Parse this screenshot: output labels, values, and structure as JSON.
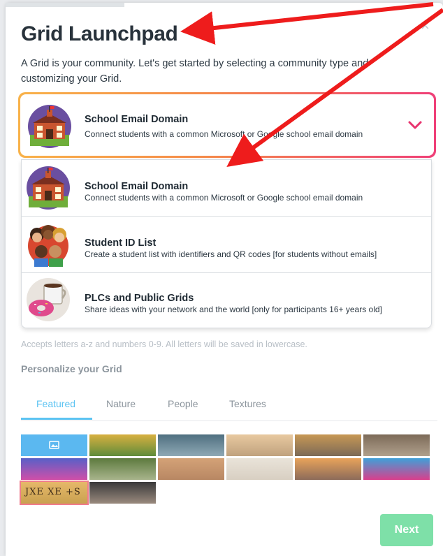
{
  "modal": {
    "title": "Grid Launchpad",
    "close_symbol": "×",
    "intro": "A Grid is your community. Let's get started by selecting a community type and customizing your Grid."
  },
  "selected_type": {
    "title": "School Email Domain",
    "description": "Connect students with a common Microsoft or Google school email domain",
    "icon": "school-building-icon"
  },
  "options": [
    {
      "title": "School Email Domain",
      "description": "Connect students with a common Microsoft or Google school email domain",
      "icon": "school-building-icon"
    },
    {
      "title": "Student ID List",
      "description": "Create a student list with identifiers and QR codes [for students without emails]",
      "icon": "students-group-icon"
    },
    {
      "title": "PLCs and Public Grids",
      "description": "Share ideas with your network and the world [only for participants 16+ years old]",
      "icon": "coffee-donut-icon"
    }
  ],
  "hint": "Accepts letters a-z and numbers 0-9. All letters will be saved in lowercase.",
  "personalize": {
    "label": "Personalize your Grid",
    "tabs": [
      {
        "label": "Featured",
        "active": true
      },
      {
        "label": "Nature",
        "active": false
      },
      {
        "label": "People",
        "active": false
      },
      {
        "label": "Textures",
        "active": false
      }
    ],
    "thumbnails": [
      {
        "name": "upload-image",
        "colors": [
          "#5bb8f0",
          "#5bb8f0"
        ]
      },
      {
        "name": "green-hills",
        "colors": [
          "#d8b040",
          "#5f8c3a"
        ]
      },
      {
        "name": "elephant",
        "colors": [
          "#4f6f80",
          "#8fa9b5"
        ]
      },
      {
        "name": "people-cheering",
        "colors": [
          "#e8c9a0",
          "#c0a27e"
        ]
      },
      {
        "name": "temple-city",
        "colors": [
          "#c79855",
          "#7c6a56"
        ]
      },
      {
        "name": "pug-dog",
        "colors": [
          "#7c6a58",
          "#b0a08c"
        ]
      },
      {
        "name": "colorful-bokeh",
        "colors": [
          "#5860c8",
          "#d04fa8"
        ]
      },
      {
        "name": "mountain-valley",
        "colors": [
          "#5d7a3e",
          "#a8b48c"
        ]
      },
      {
        "name": "desert-animal",
        "colors": [
          "#d4a277",
          "#b88763"
        ]
      },
      {
        "name": "cat-glasses",
        "colors": [
          "#e9e3d9",
          "#d8cfc2"
        ]
      },
      {
        "name": "city-sunset",
        "colors": [
          "#e8a35a",
          "#8c6b5a"
        ]
      },
      {
        "name": "color-powder",
        "colors": [
          "#3fa0d8",
          "#d83f8c"
        ]
      },
      {
        "name": "mirror-text",
        "colors": [
          "#e6b86a",
          "#c9a150"
        ],
        "text": "JXE XE +S",
        "selected": true
      },
      {
        "name": "laughing-woman",
        "colors": [
          "#3a3a3a",
          "#9a8a7e"
        ]
      }
    ]
  },
  "next_label": "Next"
}
